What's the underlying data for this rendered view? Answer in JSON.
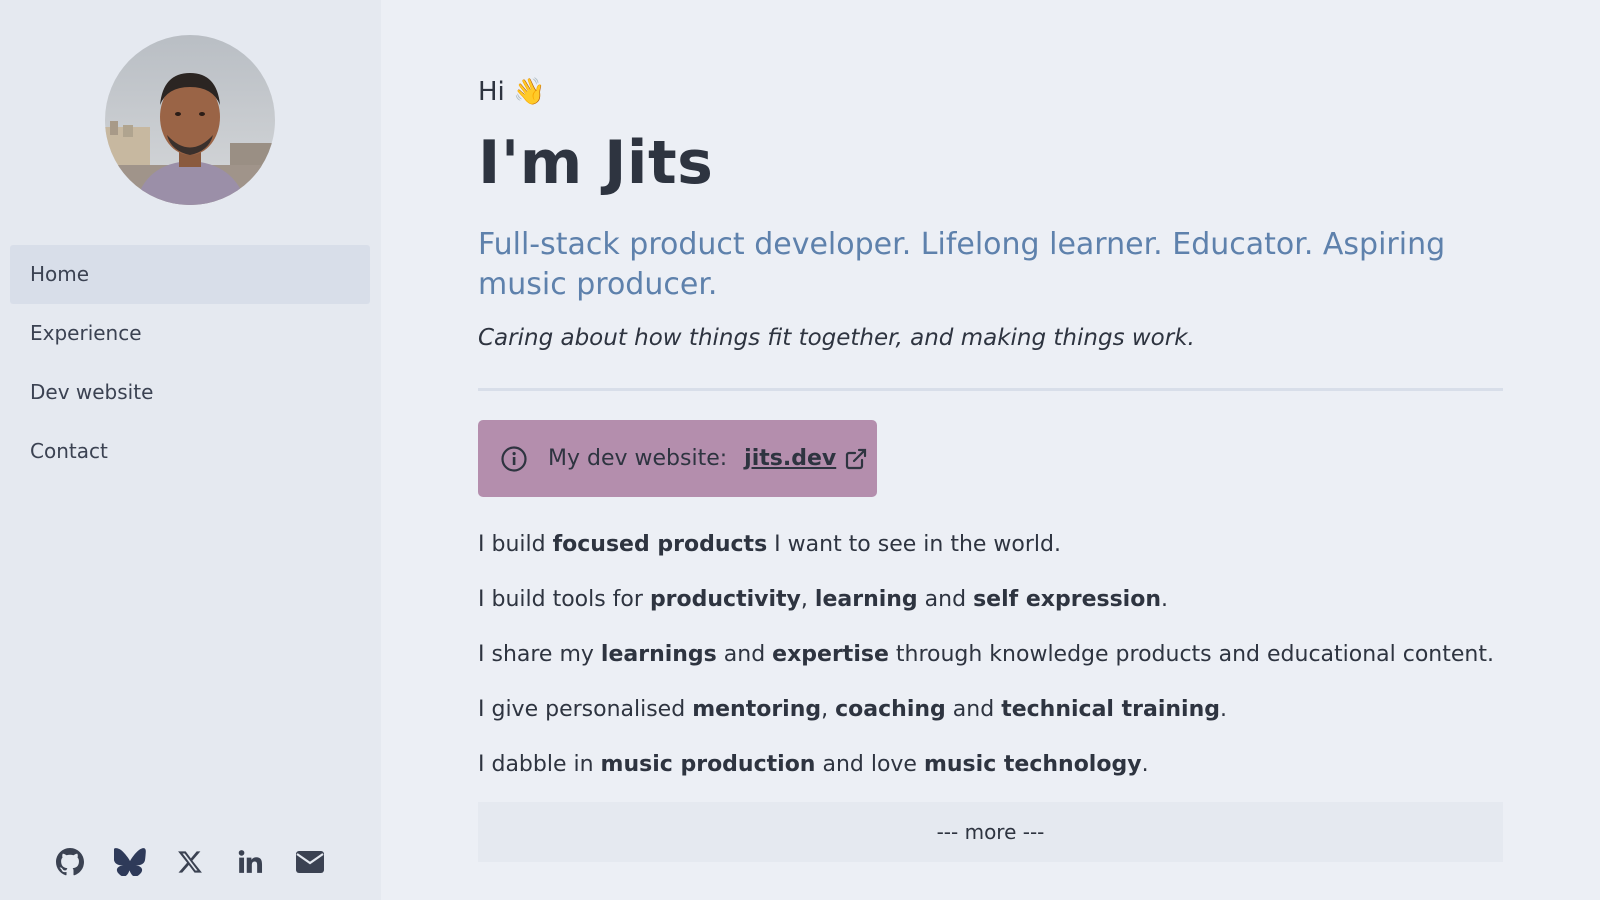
{
  "sidebar": {
    "avatar_alt": "Jits",
    "nav": [
      {
        "label": "Home",
        "active": true
      },
      {
        "label": "Experience",
        "active": false
      },
      {
        "label": "Dev website",
        "active": false
      },
      {
        "label": "Contact",
        "active": false
      }
    ],
    "socials": [
      "github-icon",
      "bluesky-icon",
      "x-icon",
      "linkedin-icon",
      "email-icon"
    ]
  },
  "main": {
    "greeting": "Hi 👋",
    "name": "I'm Jits",
    "tagline": "Full-stack product developer. Lifelong learner. Educator. Aspiring music producer.",
    "motto": "Caring about how things fit together, and making things work.",
    "callout": {
      "text": "My dev website:",
      "link": "jits.dev"
    },
    "paragraphs": [
      [
        {
          "t": "I build ",
          "b": false
        },
        {
          "t": "focused products",
          "b": true
        },
        {
          "t": " I want to see in the world.",
          "b": false
        }
      ],
      [
        {
          "t": "I build tools for ",
          "b": false
        },
        {
          "t": "productivity",
          "b": true
        },
        {
          "t": ", ",
          "b": false
        },
        {
          "t": "learning",
          "b": true
        },
        {
          "t": " and ",
          "b": false
        },
        {
          "t": "self expression",
          "b": true
        },
        {
          "t": ".",
          "b": false
        }
      ],
      [
        {
          "t": "I share my ",
          "b": false
        },
        {
          "t": "learnings",
          "b": true
        },
        {
          "t": " and ",
          "b": false
        },
        {
          "t": "expertise",
          "b": true
        },
        {
          "t": " through knowledge products and educational content.",
          "b": false
        }
      ],
      [
        {
          "t": "I give personalised ",
          "b": false
        },
        {
          "t": "mentoring",
          "b": true
        },
        {
          "t": ", ",
          "b": false
        },
        {
          "t": "coaching",
          "b": true
        },
        {
          "t": " and ",
          "b": false
        },
        {
          "t": "technical training",
          "b": true
        },
        {
          "t": ".",
          "b": false
        }
      ],
      [
        {
          "t": "I dabble in ",
          "b": false
        },
        {
          "t": "music production",
          "b": true
        },
        {
          "t": " and love ",
          "b": false
        },
        {
          "t": "music technology",
          "b": true
        },
        {
          "t": ".",
          "b": false
        }
      ]
    ],
    "more_label": "--- more ---"
  },
  "colors": {
    "background": "#eceff5",
    "sidebar": "#e5e9f0",
    "accent_blue": "#5e81ac",
    "callout_bg": "#b48ead",
    "text": "#2e3440"
  }
}
